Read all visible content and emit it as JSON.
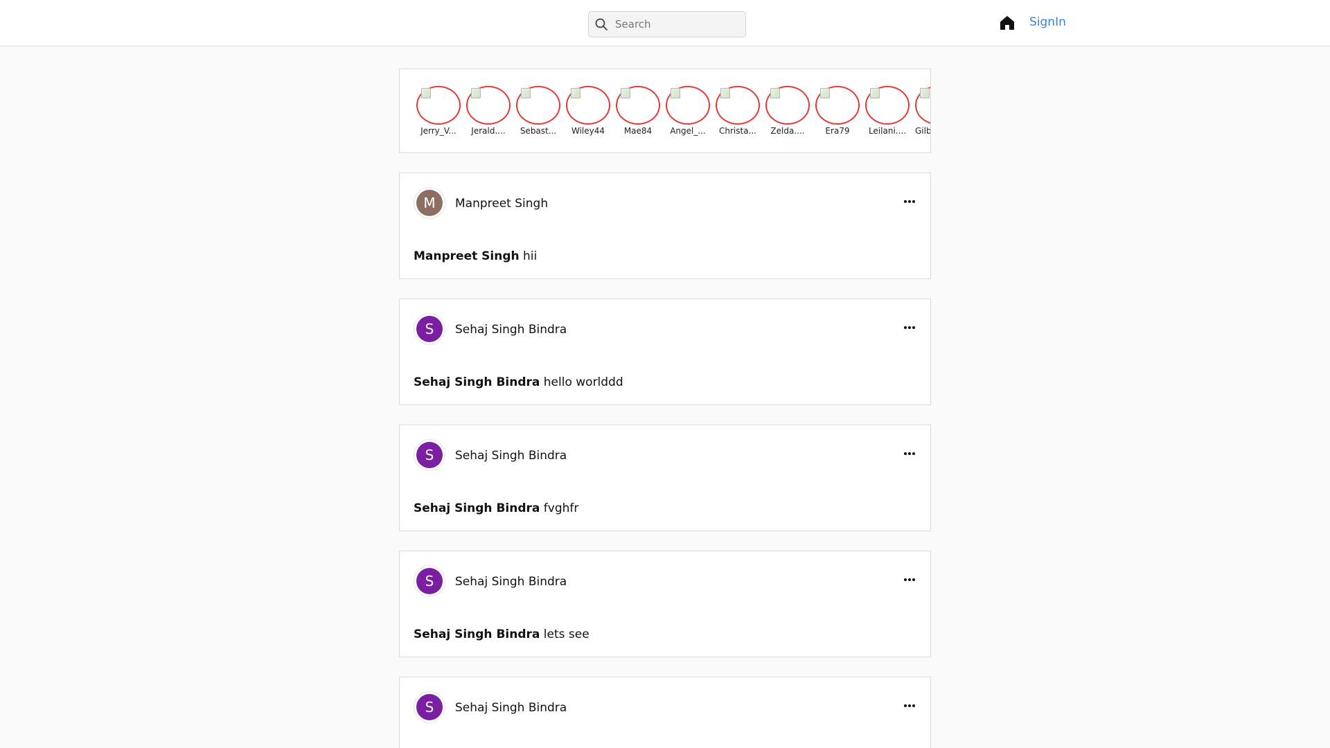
{
  "header": {
    "search_placeholder": "Search",
    "signin_label": "SignIn"
  },
  "stories": [
    {
      "username": "Jerry_V..."
    },
    {
      "username": "Jerald...."
    },
    {
      "username": "Sebast..."
    },
    {
      "username": "Wiley44"
    },
    {
      "username": "Mae84"
    },
    {
      "username": "Angel_..."
    },
    {
      "username": "Christa..."
    },
    {
      "username": "Zelda...."
    },
    {
      "username": "Era79"
    },
    {
      "username": "Leilani...."
    },
    {
      "username": "Gilb"
    }
  ],
  "posts": [
    {
      "author": "Manpreet Singh",
      "initial": "M",
      "avatar_color": "#8d6e63",
      "caption_author": "Manpreet Singh",
      "caption": "hii"
    },
    {
      "author": "Sehaj Singh Bindra",
      "initial": "S",
      "avatar_color": "#7b1fa2",
      "caption_author": "Sehaj Singh Bindra",
      "caption": "hello worlddd"
    },
    {
      "author": "Sehaj Singh Bindra",
      "initial": "S",
      "avatar_color": "#7b1fa2",
      "caption_author": "Sehaj Singh Bindra",
      "caption": "fvghfr"
    },
    {
      "author": "Sehaj Singh Bindra",
      "initial": "S",
      "avatar_color": "#7b1fa2",
      "caption_author": "Sehaj Singh Bindra",
      "caption": "lets see"
    },
    {
      "author": "Sehaj Singh Bindra",
      "initial": "S",
      "avatar_color": "#7b1fa2"
    }
  ],
  "icons": {
    "search": "search-icon",
    "home": "home-icon",
    "more": "more-horizontal-icon"
  }
}
